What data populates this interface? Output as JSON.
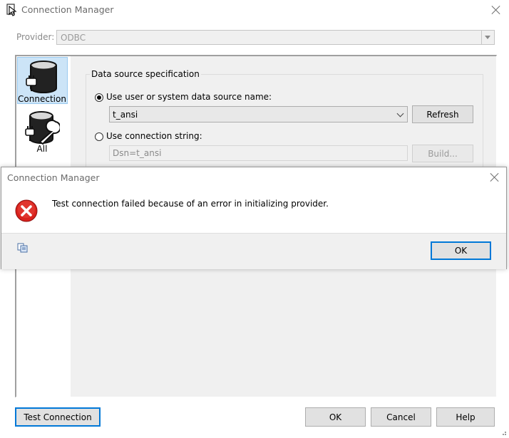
{
  "window": {
    "title": "Connection Manager"
  },
  "provider": {
    "label": "Provider:",
    "value": "ODBC"
  },
  "nav": {
    "items": [
      {
        "label": "Connection",
        "selected": true
      },
      {
        "label": "All",
        "selected": false
      }
    ]
  },
  "datasource": {
    "group_title": "Data source specification",
    "option_dsn_label": "Use user or system data source name:",
    "dsn_value": "t_ansi",
    "refresh_label": "Refresh",
    "option_connstr_label": "Use connection string:",
    "connstr_value": "Dsn=t_ansi",
    "build_label": "Build..."
  },
  "footer": {
    "test_connection_label": "Test Connection",
    "ok_label": "OK",
    "cancel_label": "Cancel",
    "help_label": "Help"
  },
  "error_dialog": {
    "title": "Connection Manager",
    "message": "Test connection failed because of an error in initializing provider.",
    "ok_label": "OK",
    "icon": "error-icon"
  },
  "colors": {
    "accent": "#0078d7",
    "selected_nav_bg": "#cce4f7",
    "error_red": "#d9221c"
  }
}
